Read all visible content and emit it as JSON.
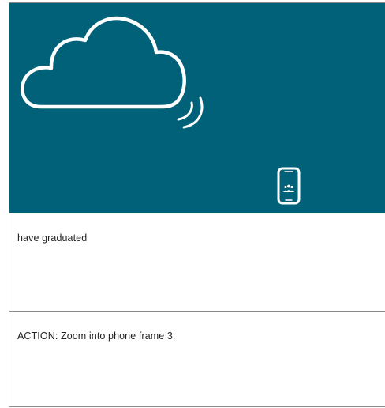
{
  "colors": {
    "banner_bg": "#006179",
    "icon_stroke": "#ffffff",
    "border": "#8a8a8a",
    "text": "#222222"
  },
  "illustration": {
    "icons": [
      "cloud-icon",
      "signal-waves-icon",
      "phone-icon",
      "people-group-icon"
    ]
  },
  "caption": {
    "text": "have graduated"
  },
  "action": {
    "text": "ACTION: Zoom into phone frame 3."
  }
}
